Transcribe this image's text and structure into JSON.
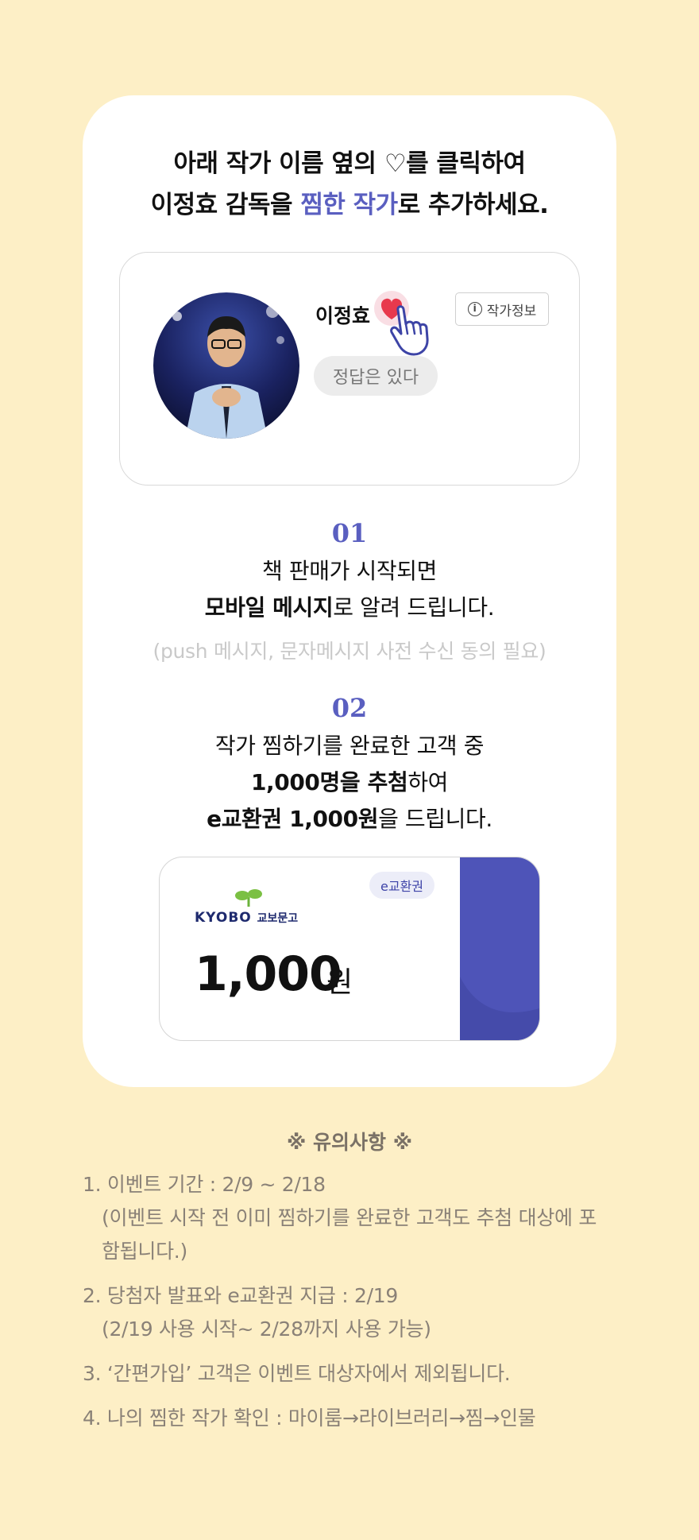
{
  "colors": {
    "page_bg": "#FDEFC6",
    "accent": "#5A5FC0",
    "heart": "#E8394D",
    "voucher_band": "#4E54B8"
  },
  "headline": {
    "line1_before": "아래 작가 이름 옆의 ",
    "line1_heart": "♡",
    "line1_after": "를 클릭하여",
    "line2_before": "이정효 감독을 ",
    "line2_accent": "찜한 작가",
    "line2_after": "로 추가하세요."
  },
  "author": {
    "name": "이정효",
    "info_button": "작가정보",
    "book_tag": "정답은 있다",
    "icons": [
      "heart-icon",
      "pointer-hand-icon",
      "info-icon"
    ]
  },
  "step1": {
    "number": "01",
    "line1": "책 판매가 시작되면",
    "line2_bold": "모바일 메시지",
    "line2_rest": "로 알려 드립니다.",
    "note": "(push 메시지, 문자메시지 사전 수신 동의 필요)"
  },
  "step2": {
    "number": "02",
    "line1": "작가 찜하기를 완료한 고객 중",
    "line2_bold": "1,000명을 추첨",
    "line2_rest": "하여",
    "line3_bold": "e교환권 1,000원",
    "line3_rest": "을 드립니다."
  },
  "voucher": {
    "badge": "e교환권",
    "logo_en": "KYOBO",
    "logo_kr": "교보문고",
    "amount": "1,000",
    "unit": "원"
  },
  "notice": {
    "title": "※ 유의사항 ※",
    "item1": "1. 이벤트 기간 : 2/9 ~ 2/18",
    "item1_sub": "(이벤트 시작 전 이미 찜하기를 완료한 고객도 추첨 대상에 포함됩니다.)",
    "item2": "2. 당첨자 발표와 e교환권 지급 : 2/19",
    "item2_sub": "(2/19 사용 시작~ 2/28까지 사용 가능)",
    "item3": "3. ‘간편가입’ 고객은 이벤트 대상자에서 제외됩니다.",
    "item4": "4. 나의 찜한 작가 확인 : 마이룸→라이브러리→찜→인물"
  }
}
